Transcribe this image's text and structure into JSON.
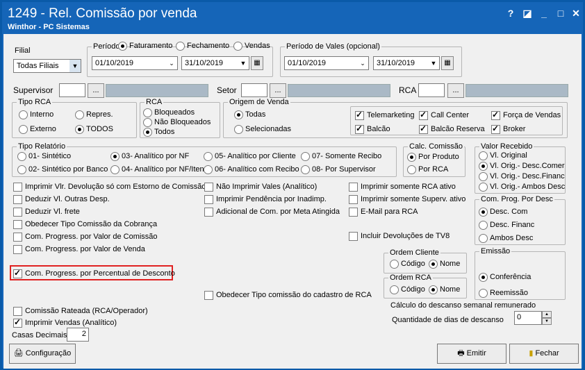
{
  "window": {
    "title": "1249 - Rel. Comissão por venda",
    "subtitle": "Winthor - PC Sistemas",
    "help": "?",
    "restore": "◪",
    "minimize": "_",
    "maximize": "□",
    "close": "✕"
  },
  "filial": {
    "label": "Filial",
    "value": "Todas Filiais"
  },
  "periodo": {
    "label": "Período:",
    "opt1": "Faturamento",
    "opt2": "Fechamento",
    "opt3": "Vendas",
    "date_from": "01/10/2019",
    "date_to": "31/10/2019"
  },
  "vales": {
    "label": "Período de Vales (opcional)",
    "date_from": "01/10/2019",
    "date_to": "31/10/2019"
  },
  "supervisor": {
    "label": "Supervisor",
    "btn": "..."
  },
  "setor": {
    "label": "Setor",
    "btn": "..."
  },
  "rca": {
    "label": "RCA",
    "btn": "..."
  },
  "tipo_rca": {
    "title": "Tipo RCA",
    "interno": "Interno",
    "repres": "Repres.",
    "externo": "Externo",
    "todos": "TODOS"
  },
  "rca_group": {
    "title": "RCA",
    "bloqueados": "Bloqueados",
    "nao_bloqueados": "Não Bloqueados",
    "todos": "Todos"
  },
  "origem": {
    "title": "Origem de Venda",
    "todas": "Todas",
    "selecionadas": "Selecionadas",
    "telemarketing": "Telemarketing",
    "call_center": "Call Center",
    "forca_vendas": "Força de Vendas",
    "balcao": "Balcão",
    "balcao_reserva": "Balcão Reserva",
    "broker": "Broker"
  },
  "tipo_relatorio": {
    "title": "Tipo Relatório",
    "o1": "01- Sintético",
    "o2": "02- Sintético por Banco",
    "o3": "03- Analítico por NF",
    "o4": "04- Analítico por NF/Itens",
    "o5": "05- Analítico por Cliente",
    "o6": "06- Analítico com Recibo",
    "o7": "07- Somente Recibo",
    "o8": "08- Por Supervisor"
  },
  "calc_comissao": {
    "title": "Calc. Comissão",
    "por_produto": "Por Produto",
    "por_rca": "Por RCA"
  },
  "valor_recebido": {
    "title": "Valor Recebido",
    "original": "Vl. Original",
    "orig_desc_comer": "Vl. Orig.- Desc.Comer",
    "orig_desc_financ": "Vl. Orig.- Desc.Financ",
    "orig_ambos": "Vl. Orig.- Ambos Desc"
  },
  "checks": {
    "c1": "Imprimir Vlr. Devolução só com Estorno de Comissão",
    "c2": "Deduzir Vl. Outras Desp.",
    "c3": "Deduzir Vl. frete",
    "c4": "Obedecer Tipo Comissão da Cobrança",
    "c5": "Com. Progress. por Valor de Comissão",
    "c6": "Com. Progress. por Valor de Venda",
    "c7": "Com. Progress. por Percentual de Desconto",
    "c8": "Não Imprimir Vales (Analítico)",
    "c9": "Imprimir Pendência por Inadimp.",
    "c10": "Adicional de Com. por Meta Atingida",
    "c11": "Imprimir somente RCA ativo",
    "c12": "Imprimir somente Superv. ativo",
    "c13": "E-Mail para RCA",
    "c14": "Incluir Devoluções de TV8",
    "c15": "Obedecer Tipo comissão do cadastro de RCA",
    "c16": "Comissão Rateada (RCA/Operador)",
    "c17": "Imprimir Vendas (Analítico)"
  },
  "com_prog": {
    "title": "Com. Prog. Por Desc",
    "desc_com": "Desc. Com",
    "desc_financ": "Desc. Financ",
    "ambos": "Ambos Desc"
  },
  "ordem_cliente": {
    "title": "Ordem Cliente",
    "codigo": "Código",
    "nome": "Nome"
  },
  "ordem_rca": {
    "title": "Ordem RCA",
    "codigo": "Código",
    "nome": "Nome"
  },
  "emissao": {
    "title": "Emissão",
    "conferencia": "Conferência",
    "reemissao": "Reemissão"
  },
  "descanso": {
    "title": "Cálculo do descanso semanal remunerado",
    "label": "Quantidade de dias de descanso",
    "value": "0"
  },
  "casas": {
    "label": "Casas Decimais",
    "value": "2"
  },
  "buttons": {
    "config": "Configuração",
    "emitir": "Emitir",
    "fechar": "Fechar"
  }
}
